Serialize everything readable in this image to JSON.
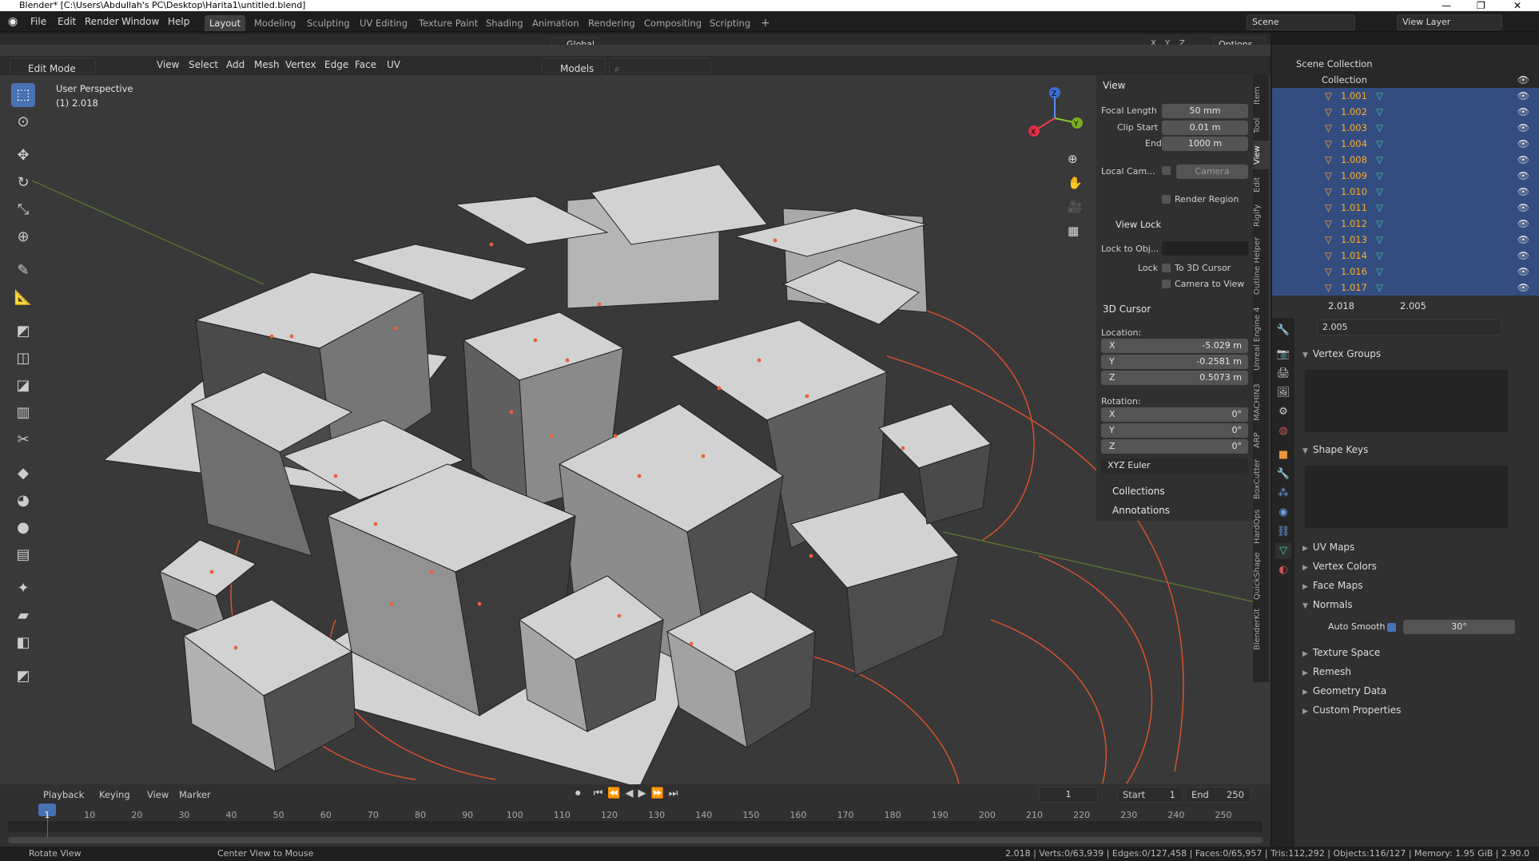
{
  "title_bar": "Blender* [C:\\Users\\Abdullah's PC\\Desktop\\Harita1\\untitled.blend]",
  "window_controls": {
    "minimize": "—",
    "maximize": "❐",
    "close": "✕"
  },
  "menu": [
    "File",
    "Edit",
    "Render",
    "Window",
    "Help"
  ],
  "workspaces": [
    "Layout",
    "Modeling",
    "Sculpting",
    "UV Editing",
    "Texture Paint",
    "Shading",
    "Animation",
    "Rendering",
    "Compositing",
    "Scripting",
    "+"
  ],
  "active_workspace": "Layout",
  "scene": "Scene",
  "view_layer": "View Layer",
  "header": {
    "transform_orientation": "Global",
    "options": "Options",
    "axes": [
      "X",
      "Y",
      "Z"
    ]
  },
  "viewport_header": {
    "mode": "Edit Mode",
    "menus": [
      "View",
      "Select",
      "Add",
      "Mesh",
      "Vertex",
      "Edge",
      "Face",
      "UV"
    ],
    "collection": "Models"
  },
  "viewport": {
    "perspective": "User Perspective",
    "object_info": "(1) 2.018",
    "gizmo": {
      "x": "X",
      "y": "Y",
      "z": "Z"
    },
    "accent_color": "#e8633a"
  },
  "npanel": {
    "tabs": [
      "Item",
      "Tool",
      "View",
      "Edit",
      "Rigify",
      "Outline Helper",
      "Unreal Engine 4",
      "MACHIN3",
      "ARP",
      "BoxCutter",
      "HardOps",
      "QuickShape",
      "BlenderKit"
    ],
    "view": {
      "header": "View",
      "focal_length_label": "Focal Length",
      "focal_length": "50 mm",
      "clip_start_label": "Clip Start",
      "clip_start": "0.01 m",
      "end_label": "End",
      "end": "1000 m",
      "local_camera_label": "Local Cam...",
      "camera": "Camera",
      "render_region": "Render Region"
    },
    "view_lock": {
      "header": "View Lock",
      "lock_to_obj": "Lock to Obj...",
      "lock": "Lock",
      "to_3d_cursor": "To 3D Cursor",
      "camera_to_view": "Camera to View"
    },
    "cursor": {
      "header": "3D Cursor",
      "location": "Location:",
      "x_label": "X",
      "x": "-5.029 m",
      "y_label": "Y",
      "y": "-0.2581 m",
      "z_label": "Z",
      "z": "0.5073 m",
      "rotation": "Rotation:",
      "rx": "0°",
      "ry": "0°",
      "rz": "0°",
      "rotation_mode": "XYZ Euler"
    },
    "collections": "Collections",
    "annotations": "Annotations"
  },
  "timeline": {
    "menus": [
      "Playback",
      "Keying",
      "View",
      "Marker"
    ],
    "current_frame": "1",
    "start_label": "Start",
    "start": "1",
    "end_label": "End",
    "end": "250",
    "ticks": [
      "1",
      "10",
      "20",
      "30",
      "40",
      "50",
      "60",
      "70",
      "80",
      "90",
      "100",
      "110",
      "120",
      "130",
      "140",
      "150",
      "160",
      "170",
      "180",
      "190",
      "200",
      "210",
      "220",
      "230",
      "240",
      "250"
    ]
  },
  "status": {
    "left1": "Rotate View",
    "left2": "Center View to Mouse",
    "right": "2.018 | Verts:0/63,939 | Edges:0/127,458 | Faces:0/65,957 | Tris:112,292 | Objects:116/127 | Memory: 1.95 GiB | 2.90.0"
  },
  "outliner": {
    "scene_collection": "Scene Collection",
    "collection": "Collection",
    "items": [
      "1.001",
      "1.002",
      "1.003",
      "1.004",
      "1.008",
      "1.009",
      "1.010",
      "1.011",
      "1.012",
      "1.013",
      "1.014",
      "1.016",
      "1.017"
    ]
  },
  "properties": {
    "object_name": "2.018",
    "mesh_name": "2.005",
    "data_name": "2.005",
    "sections": {
      "vertex_groups": "Vertex Groups",
      "shape_keys": "Shape Keys",
      "uv_maps": "UV Maps",
      "vertex_colors": "Vertex Colors",
      "face_maps": "Face Maps",
      "normals": "Normals",
      "texture_space": "Texture Space",
      "remesh": "Remesh",
      "geometry_data": "Geometry Data",
      "custom_properties": "Custom Properties"
    },
    "auto_smooth_label": "Auto Smooth",
    "auto_smooth_angle": "30°"
  }
}
